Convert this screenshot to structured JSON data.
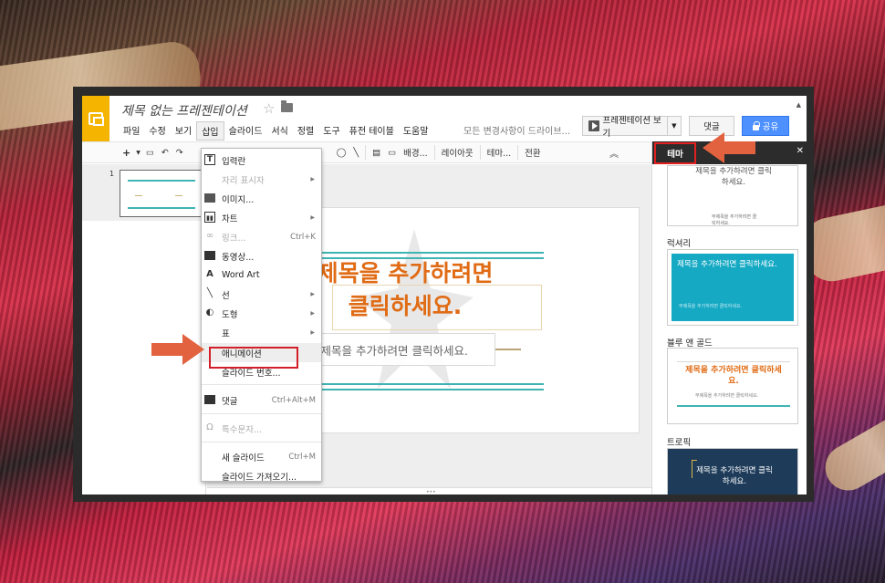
{
  "app": {
    "doc_title": "제목 없는 프레젠테이션",
    "save_status": "모든 변경사항이 드라이브...",
    "present_label": "프레젠테이션 보기",
    "comment_label": "댓글",
    "share_label": "공유"
  },
  "menubar": [
    "파일",
    "수정",
    "보기",
    "삽입",
    "슬라이드",
    "서식",
    "정렬",
    "도구",
    "퓨전 테이블",
    "도움말"
  ],
  "toolbar": {
    "plus": "+",
    "background": "배경...",
    "layout": "레이아웃",
    "theme": "테마...",
    "transition": "전환"
  },
  "filmstrip": {
    "slide_number": "1"
  },
  "slide": {
    "title_line1": "제목을 추가하려면",
    "title_line2": "클릭하세요.",
    "subtitle": "부제목을 추가하려면 클릭하세요."
  },
  "insert_menu": [
    {
      "label": "입력란",
      "icon": "text-box-icon",
      "shortcut": "",
      "submenu": false,
      "disabled": false
    },
    {
      "label": "자리 표시자",
      "icon": "",
      "shortcut": "",
      "submenu": true,
      "disabled": true
    },
    {
      "label": "이미지...",
      "icon": "image-icon",
      "shortcut": "",
      "submenu": false,
      "disabled": false
    },
    {
      "label": "차트",
      "icon": "chart-icon",
      "shortcut": "",
      "submenu": true,
      "disabled": false
    },
    {
      "label": "링크...",
      "icon": "link-icon",
      "shortcut": "Ctrl+K",
      "submenu": false,
      "disabled": true
    },
    {
      "label": "동영상...",
      "icon": "video-icon",
      "shortcut": "",
      "submenu": false,
      "disabled": false
    },
    {
      "label": "Word Art",
      "icon": "word-art-icon",
      "shortcut": "",
      "submenu": false,
      "disabled": false
    },
    {
      "label": "선",
      "icon": "line-icon",
      "shortcut": "",
      "submenu": true,
      "disabled": false
    },
    {
      "label": "도형",
      "icon": "shape-icon",
      "shortcut": "",
      "submenu": true,
      "disabled": false
    },
    {
      "label": "표",
      "icon": "",
      "shortcut": "",
      "submenu": true,
      "disabled": false
    },
    {
      "label": "애니메이션",
      "icon": "",
      "shortcut": "",
      "submenu": false,
      "disabled": false
    },
    {
      "label": "슬라이드 번호...",
      "icon": "",
      "shortcut": "",
      "submenu": false,
      "disabled": false
    },
    {
      "label": "댓글",
      "icon": "comment-icon",
      "shortcut": "Ctrl+Alt+M",
      "submenu": false,
      "disabled": false
    },
    {
      "label": "특수문자...",
      "icon": "omega-icon",
      "shortcut": "",
      "submenu": false,
      "disabled": true
    },
    {
      "label": "새 슬라이드",
      "icon": "",
      "shortcut": "Ctrl+M",
      "submenu": false,
      "disabled": false
    },
    {
      "label": "슬라이드 가져오기...",
      "icon": "",
      "shortcut": "",
      "submenu": false,
      "disabled": false
    }
  ],
  "theme_panel": {
    "tab_label": "테마",
    "themes": [
      {
        "name": "",
        "title": "제목을 추가하려면 클릭하세요.",
        "subtitle": "부제목을 추가하려면 클릭하세요."
      },
      {
        "name": "럭셔리",
        "title": "제목을 추가하려면 클릭하세요.",
        "subtitle": "부제목을 추가하려면 클릭하세요."
      },
      {
        "name": "블루 앤 골드",
        "title": "제목을 추가하려면 클릭하세요.",
        "subtitle": "부제목을 추가하려면 클릭하세요."
      },
      {
        "name": "트로픽",
        "title": "제목을 추가하려면 클릭하세요.",
        "subtitle": ""
      }
    ]
  },
  "colors": {
    "accent_orange": "#e06b15",
    "teal": "#3fb4b3",
    "highlight_red": "#d21f2a",
    "arrow_orange": "#e2623f",
    "share_blue": "#4d90fe"
  }
}
